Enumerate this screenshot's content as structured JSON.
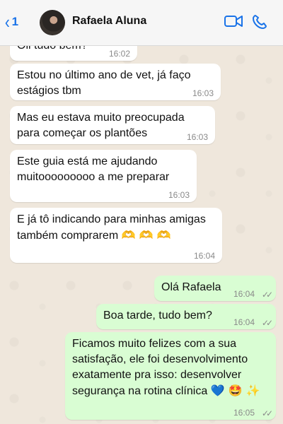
{
  "header": {
    "back_count": "1",
    "contact_name": "Rafaela Aluna",
    "icons": [
      "chevron-left-icon",
      "video-call-icon",
      "phone-icon"
    ],
    "accent_color": "#1a73e8"
  },
  "messages": [
    {
      "text": "Oii tudo bem?",
      "time": "16:02",
      "direction": "in"
    },
    {
      "text": "Estou no último ano de vet, já faço estágios tbm",
      "time": "16:03",
      "direction": "in"
    },
    {
      "text": "Mas eu estava muito preocupada para começar os plantões",
      "time": "16:03",
      "direction": "in"
    },
    {
      "text": "Este guia está me ajudando muitooooooooo a me preparar",
      "time": "16:03",
      "direction": "in"
    },
    {
      "text": "E já tô indicando para minhas amigas também comprarem",
      "emoji": "🫶 🫶 🫶",
      "time": "16:04",
      "direction": "in"
    },
    {
      "text": "Olá Rafaela",
      "time": "16:04",
      "direction": "out",
      "status": "read"
    },
    {
      "text": "Boa tarde, tudo bem?",
      "time": "16:04",
      "direction": "out",
      "status": "read"
    },
    {
      "text": "Ficamos muito felizes com a sua satisfação, ele foi desenvolvimento exatamente pra isso: desenvolver segurança na rotina clínica",
      "emoji": "💙 🤩 ✨",
      "time": "16:05",
      "direction": "out",
      "status": "read"
    }
  ],
  "colors": {
    "incoming_bubble": "#ffffff",
    "outgoing_bubble": "#d9fdd3",
    "background": "#efe7dc"
  }
}
